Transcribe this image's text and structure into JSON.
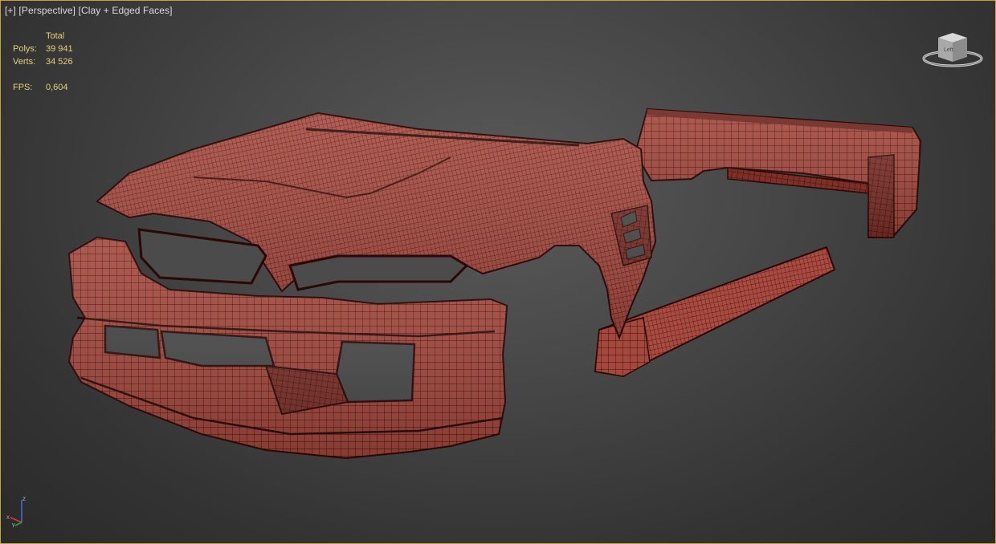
{
  "viewport": {
    "label_plus": "[+]",
    "label_view": "[Perspective]",
    "label_shading": "[Clay + Edged Faces]",
    "border_color": "#c9a13a",
    "mesh_fill": "#a4473c",
    "mesh_wire": "#3a0c08"
  },
  "stats": {
    "header": "Total",
    "polys_label": "Polys:",
    "polys_value": "39 941",
    "verts_label": "Verts:",
    "verts_value": "34 526",
    "fps_label": "FPS:",
    "fps_value": "0,604",
    "text_color": "#e3d07a"
  },
  "viewcube": {
    "label": "Left",
    "icon": "viewcube-icon"
  },
  "axis": {
    "z_label": "z",
    "x_label": "x",
    "y_label": "y",
    "icon": "axis-tripod-icon"
  }
}
